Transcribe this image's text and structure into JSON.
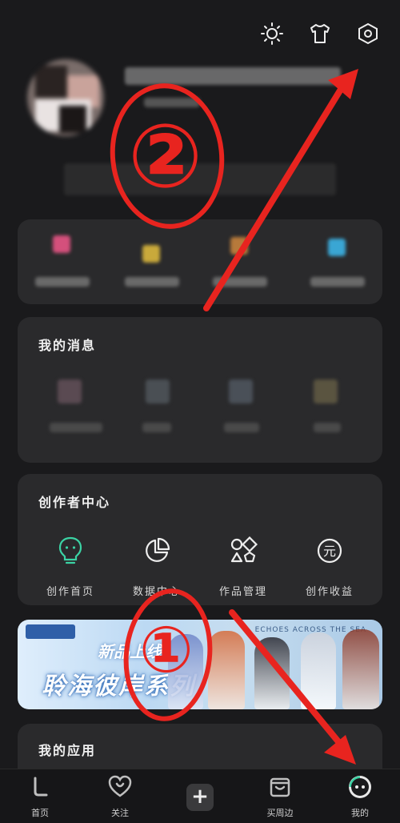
{
  "top_actions": {
    "theme_icon": "sun-icon",
    "skin_icon": "tshirt-icon",
    "settings_icon": "settings-hex-icon"
  },
  "messages": {
    "title": "我的消息"
  },
  "creator": {
    "title": "创作者中心",
    "items": [
      {
        "label": "创作首页",
        "icon": "bulb-face-icon"
      },
      {
        "label": "数据中心",
        "icon": "pie-chart-icon"
      },
      {
        "label": "作品管理",
        "icon": "shapes-icon"
      },
      {
        "label": "创作收益",
        "icon": "yuan-icon"
      }
    ]
  },
  "banner": {
    "new_tag": "新品上线",
    "series": "聆海彼岸系列",
    "brand": "ECHOES ACROSS THE SEA"
  },
  "apps": {
    "title": "我的应用"
  },
  "tabbar": {
    "items": [
      {
        "label": "首页"
      },
      {
        "label": "关注"
      },
      {
        "label": ""
      },
      {
        "label": "买周边"
      },
      {
        "label": "我的"
      }
    ]
  },
  "annotations": {
    "step1": "①",
    "step2": "②"
  },
  "colors": {
    "annotation_red": "#e8241f",
    "accent": "#3bd3a4"
  }
}
